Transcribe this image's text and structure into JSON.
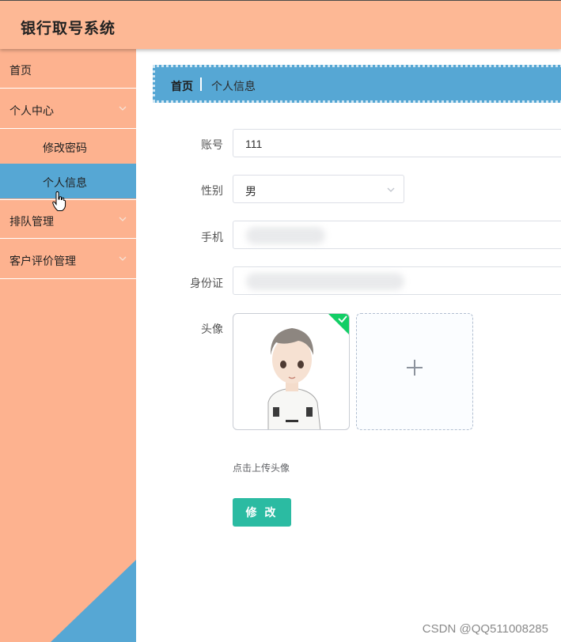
{
  "app": {
    "title": "银行取号系统"
  },
  "sidebar": {
    "home": "首页",
    "personal_center": "个人中心",
    "sub_items": [
      "修改密码",
      "个人信息"
    ],
    "queue_management": "排队管理",
    "review_management": "客户评价管理"
  },
  "breadcrumb": {
    "home": "首页",
    "current": "个人信息"
  },
  "form": {
    "account_label": "账号",
    "account_value": "111",
    "gender_label": "性别",
    "gender_value": "男",
    "phone_label": "手机",
    "idcard_label": "身份证",
    "avatar_label": "头像",
    "upload_hint": "点击上传头像",
    "submit_label": "修 改"
  },
  "icons": {
    "chevron": "chevron-down-icon",
    "plus": "plus-icon",
    "check": "check-icon",
    "cursor": "hand-cursor-icon"
  },
  "colors": {
    "header_bg": "#fdb895",
    "sidebar_bg": "#fdb28f",
    "accent_blue": "#56a7d4",
    "submit_bg": "#2bbba2",
    "success_tag": "#13ce66"
  },
  "watermark": "CSDN @QQ511008285"
}
